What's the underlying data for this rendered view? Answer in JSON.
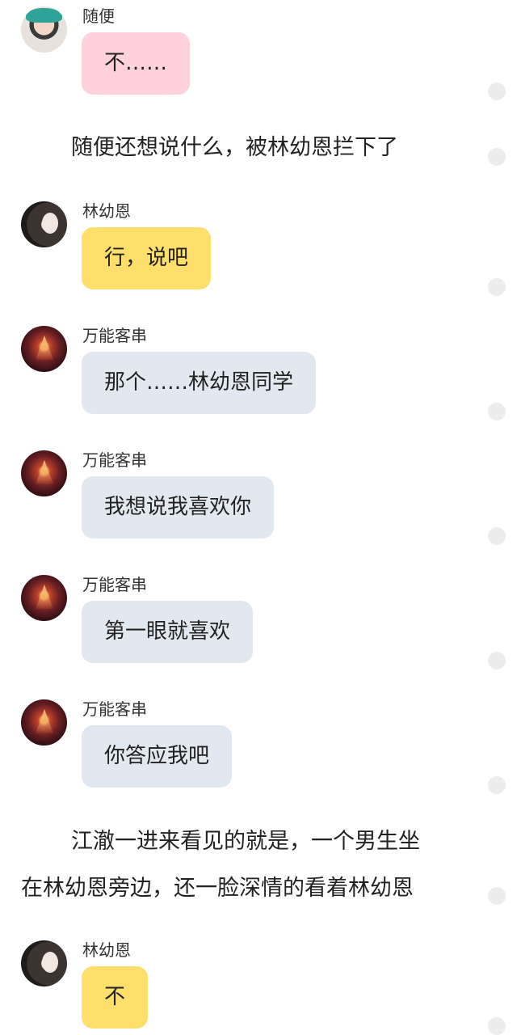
{
  "messages": [
    {
      "sender": "随便",
      "text": "不……",
      "avatar": "suibian-avatar",
      "color": "#ffd1dc"
    },
    {
      "sender": "林幼恩",
      "text": "行，说吧",
      "avatar": "lin-avatar",
      "color": "#ffdf6b"
    },
    {
      "sender": "万能客串",
      "text": "那个……林幼恩同学",
      "avatar": "wanneng-avatar",
      "color": "#e2e8f0"
    },
    {
      "sender": "万能客串",
      "text": "我想说我喜欢你",
      "avatar": "wanneng-avatar",
      "color": "#e2e8f0"
    },
    {
      "sender": "万能客串",
      "text": "第一眼就喜欢",
      "avatar": "wanneng-avatar",
      "color": "#e2e8f0"
    },
    {
      "sender": "万能客串",
      "text": "你答应我吧",
      "avatar": "wanneng-avatar",
      "color": "#e2e8f0"
    },
    {
      "sender": "林幼恩",
      "text": "不",
      "avatar": "lin-avatar",
      "color": "#ffdf6b"
    }
  ],
  "narrations": [
    "随便还想说什么，被林幼恩拦下了",
    "江澈一进来看见的就是，一个男生坐在林幼恩旁边，还一脸深情的看着林幼恩"
  ],
  "narration_lines": {
    "n2_line1": "江澈一进来看见的就是，一个男生坐",
    "n2_line2": "在林幼恩旁边，还一脸深情的看着林幼恩"
  }
}
